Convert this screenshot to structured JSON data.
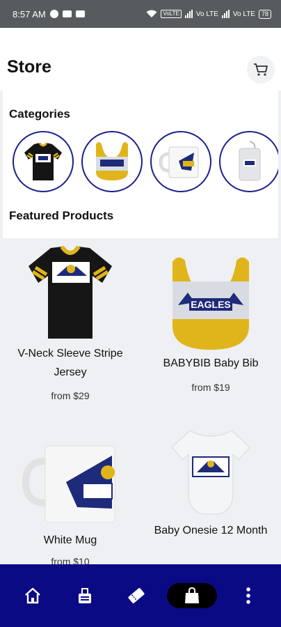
{
  "status_bar": {
    "time": "8:57 AM",
    "volte": "VoLTE",
    "net1": "Vo LTE",
    "net2": "Vo LTE",
    "battery": "78"
  },
  "header": {
    "title": "Store"
  },
  "icons": {
    "cart": "cart-icon",
    "home": "home-icon",
    "info_board": "info-board-icon",
    "ticket": "ticket-icon",
    "shopping_bag": "shopping-bag-icon",
    "more": "more-vertical-icon"
  },
  "categories": {
    "title": "Categories",
    "items": [
      "jersey",
      "baby-bib",
      "mug",
      "luggage-tag"
    ]
  },
  "featured": {
    "title": "Featured Products",
    "products": [
      {
        "name": "V-Neck Sleeve Stripe Jersey",
        "price": "from $29"
      },
      {
        "name": "BABYBIB Baby Bib",
        "price": "from $19"
      },
      {
        "name": "White Mug",
        "price": "from $10"
      },
      {
        "name": "Baby Onesie 12 Month",
        "price": ""
      }
    ]
  },
  "brand_text": "EAGLES",
  "colors": {
    "nav_background": "#0a0a85",
    "category_border": "#1b1f8c",
    "gold": "#e0b51b",
    "navy": "#1e2a7a"
  }
}
